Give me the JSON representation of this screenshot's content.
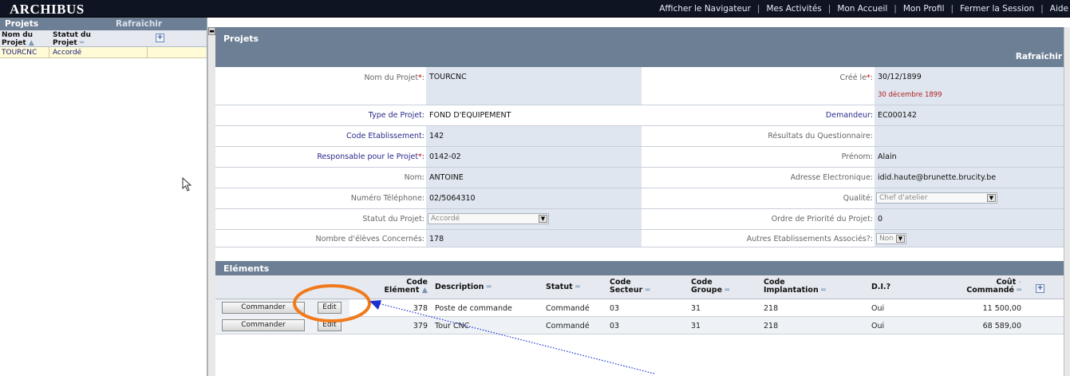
{
  "app": {
    "logo": "ARCHIBUS"
  },
  "topnav": [
    "Afficher le Navigateur",
    "Mes Activités",
    "Mon Accueil",
    "Mon Profil",
    "Fermer la Session",
    "Aide"
  ],
  "left_panel": {
    "title": "Projets",
    "refresh": "Rafraîchir",
    "col1": "Nom du Projet",
    "col2": "Statut du Projet",
    "rows": [
      {
        "name": "TOURCNC",
        "status": "Accordé"
      }
    ]
  },
  "project_form": {
    "title": "Projets",
    "refresh": "Rafraîchir",
    "fields": {
      "nom_label": "Nom du Projet",
      "nom_value": "TOURCNC",
      "cree_label": "Créé le",
      "cree_value": "30/12/1899",
      "cree_sub": "30 décembre 1899",
      "type_label": "Type de Projet:",
      "type_value": "FOND D'EQUIPEMENT",
      "demandeur_label": "Demandeur:",
      "demandeur_value": "EC000142",
      "etab_label": "Code Etablissement:",
      "etab_value": "142",
      "resultats_label": "Résultats du Questionnaire:",
      "resultats_value": "",
      "resp_label": "Responsable pour le Projet",
      "resp_value": "0142-02",
      "prenom_label": "Prénom:",
      "prenom_value": "Alain",
      "nom_label2": "Nom:",
      "nom_value2": "ANTOINE",
      "email_label": "Adresse Electronique:",
      "email_value": "idid.haute@brunette.brucity.be",
      "tel_label": "Numéro Téléphone:",
      "tel_value": "02/5064310",
      "qualite_label": "Qualité:",
      "qualite_value": "Chef d'atelier",
      "statut_label": "Statut du Projet:",
      "statut_value": "Accordé",
      "priorite_label": "Ordre de Priorité du Projet:",
      "priorite_value": "0",
      "eleves_label": "Nombre d'élèves Concernés:",
      "eleves_value": "178",
      "autres_label": "Autres Etablissements Associés?:",
      "autres_value": "Non"
    }
  },
  "elements": {
    "title": "Eléments",
    "headers": {
      "code": "Code Elément",
      "description": "Description",
      "statut": "Statut",
      "secteur": "Code Secteur",
      "groupe": "Code Groupe",
      "implantation": "Code Implantation",
      "di": "D.I.?",
      "cout": "Coût Commandé"
    },
    "buttons": {
      "commander": "Commander",
      "edit": "Edit"
    },
    "rows": [
      {
        "code": "378",
        "description": "Poste de commande",
        "statut": "Commandé",
        "secteur": "03",
        "groupe": "31",
        "implantation": "218",
        "di": "Oui",
        "cout": "11 500,00"
      },
      {
        "code": "379",
        "description": "Tour CNC",
        "statut": "Commandé",
        "secteur": "03",
        "groupe": "31",
        "implantation": "218",
        "di": "Oui",
        "cout": "68 589,00"
      }
    ]
  },
  "colors": {
    "header": "#6d7f95",
    "topbar": "#0f1422",
    "annotation_orange": "#f07a1c",
    "annotation_arrow": "#1a2fd0"
  }
}
